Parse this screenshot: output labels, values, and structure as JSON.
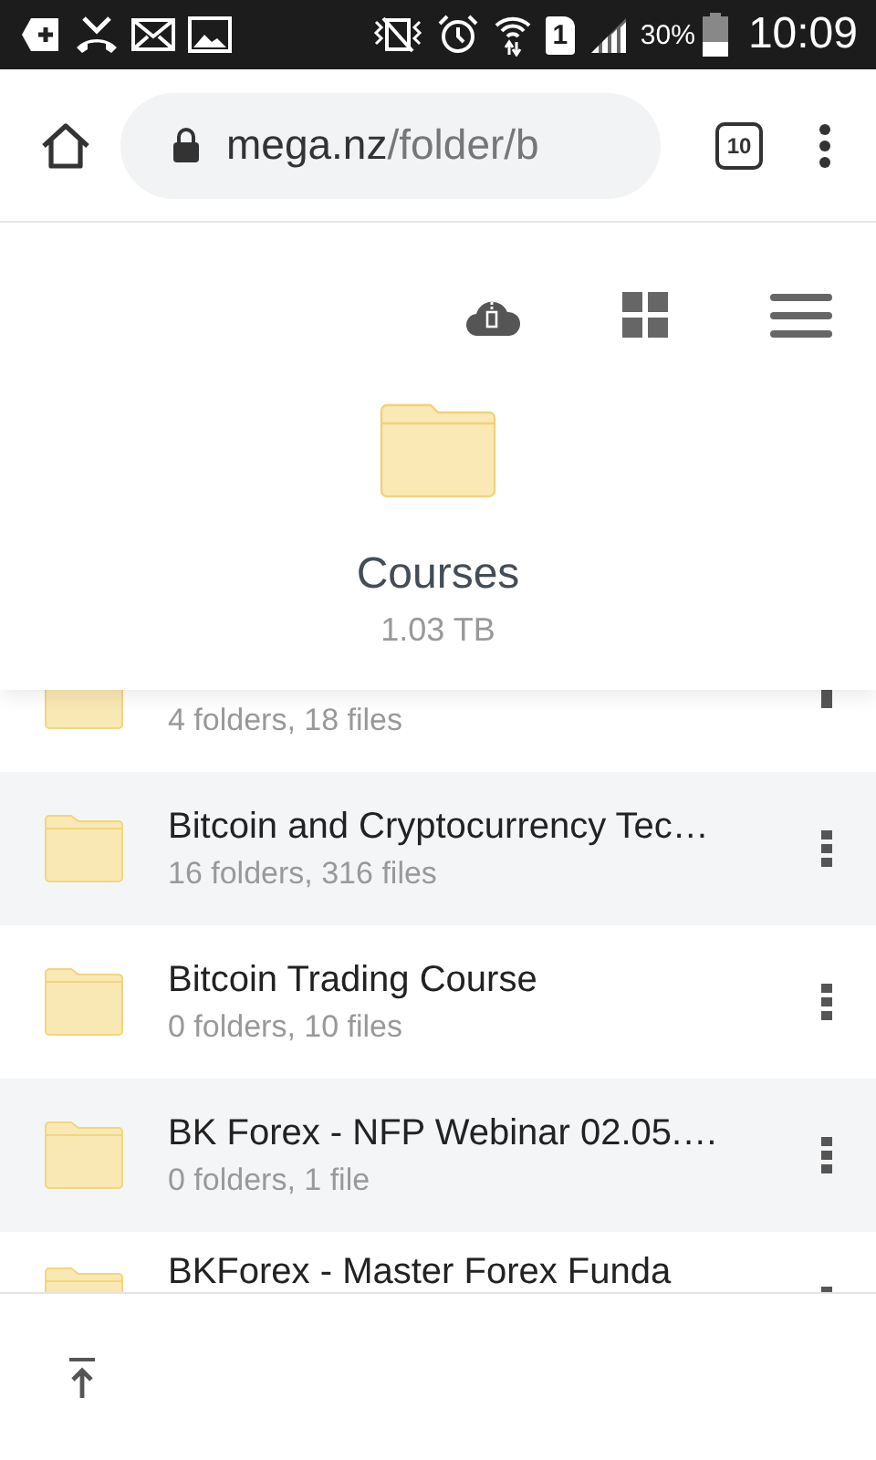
{
  "status_bar": {
    "sim": "1",
    "battery": "30%",
    "time": "10:09"
  },
  "browser": {
    "url_host": "mega.nz",
    "url_path": "/folder/b",
    "tab_count": "10"
  },
  "folder": {
    "name": "Courses",
    "size": "1.03 TB"
  },
  "items": [
    {
      "kind": "top_cut",
      "subtitle": "4 folders, 18 files"
    },
    {
      "kind": "full",
      "name": "Bitcoin and Cryptocurrency Tec…",
      "subtitle": "16 folders, 316 files"
    },
    {
      "kind": "full",
      "name": "Bitcoin Trading Course",
      "subtitle": "0 folders, 10 files"
    },
    {
      "kind": "full",
      "name": "BK Forex - NFP Webinar 02.05.…",
      "subtitle": "0 folders, 1 file"
    },
    {
      "kind": "bottom_cut",
      "name": "BKForex - Master Forex Funda"
    }
  ]
}
